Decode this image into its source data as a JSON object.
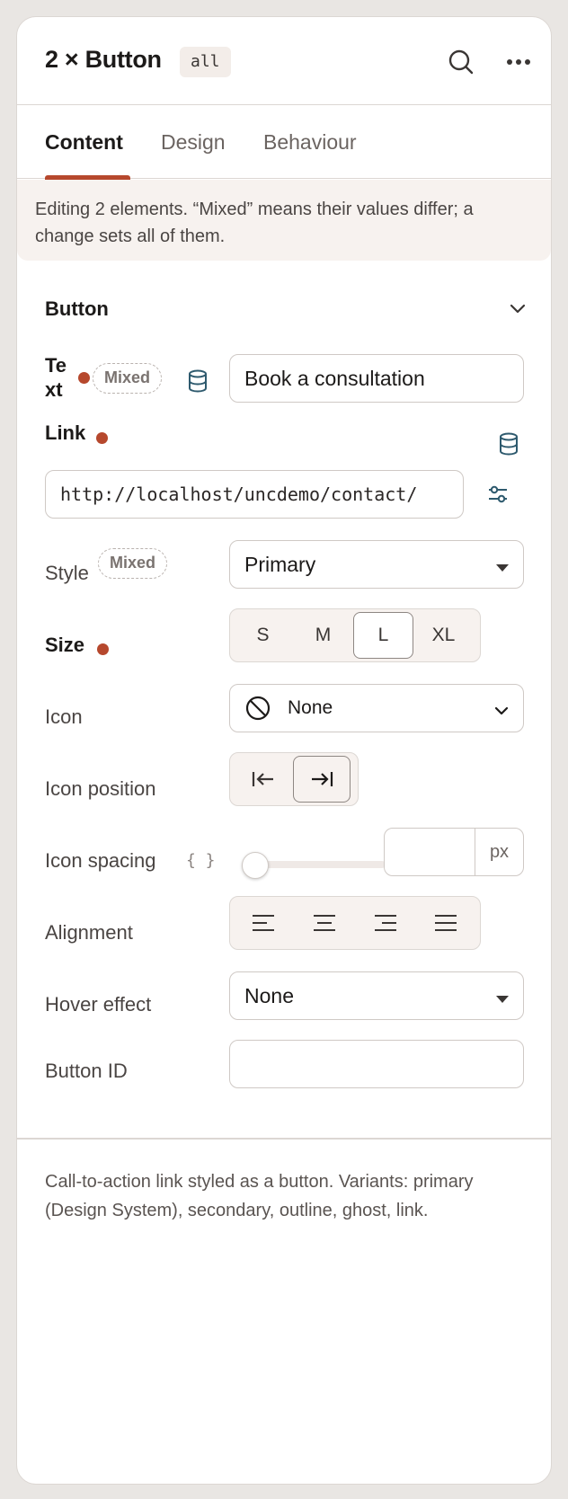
{
  "header": {
    "title": "2 × Button",
    "scope_badge": "all",
    "icons": [
      "search-icon",
      "more-icon"
    ]
  },
  "tabs": [
    {
      "label": "Content",
      "active": true
    },
    {
      "label": "Design",
      "active": false
    },
    {
      "label": "Behaviour",
      "active": false
    }
  ],
  "notice": "Editing 2 elements. “Mixed” means their values differ; a change sets all of them.",
  "section": {
    "title": "Button",
    "expanded": true
  },
  "fields": {
    "text": {
      "label_a": "Te",
      "label_b": "xt",
      "mixed": "Mixed",
      "value": "Book a consultation"
    },
    "link": {
      "label": "Link",
      "value": "http://localhost/uncdemo/contact/"
    },
    "style": {
      "label": "Style",
      "mixed": "Mixed",
      "value": "Primary"
    },
    "size": {
      "label": "Size",
      "options": [
        "S",
        "M",
        "L",
        "XL"
      ],
      "selected": "L"
    },
    "icon": {
      "label": "Icon",
      "value": "None"
    },
    "icon_position": {
      "label": "Icon position",
      "selected": "after"
    },
    "icon_spacing": {
      "label": "Icon spacing",
      "token": "{ }",
      "value": "",
      "unit": "px",
      "level": 0
    },
    "alignment": {
      "label": "Alignment",
      "options": [
        "left",
        "center",
        "right",
        "justify"
      ]
    },
    "hover_effect": {
      "label": "Hover effect",
      "value": "None"
    },
    "button_id": {
      "label": "Button ID",
      "value": ""
    }
  },
  "description": "Call-to-action link styled as a button. Variants: primary (Design System), secondary, outline, ghost, link.",
  "colors": {
    "accent": "#b6482d",
    "panel_bg": "#ffffff",
    "page_bg": "#e9e6e3",
    "icon_blue": "#2e5a6e"
  }
}
